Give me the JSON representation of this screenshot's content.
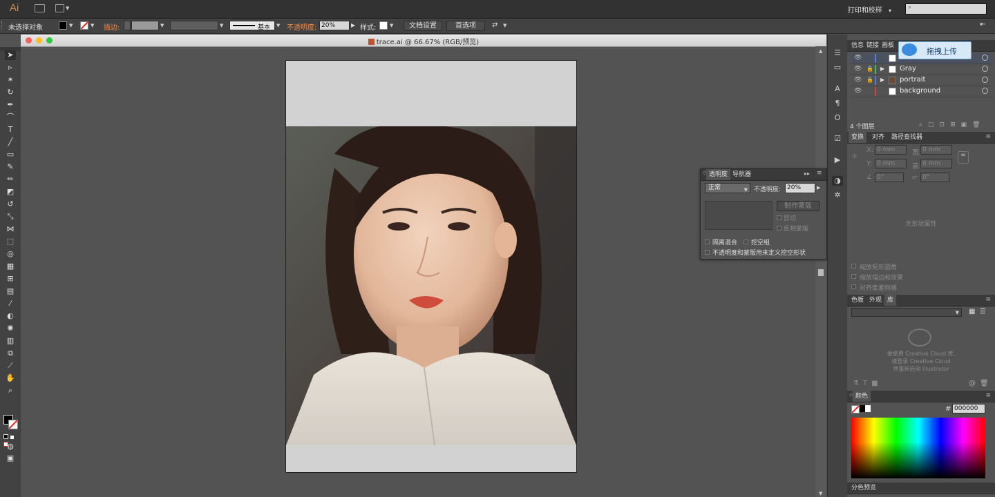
{
  "app": {
    "logo": "Ai",
    "workspace": "打印和校样",
    "workspace_arrow": "▾"
  },
  "control": {
    "selection": "未选择对象",
    "stroke_label": "描边:",
    "stroke_style": "基本",
    "opacity_label": "不透明度:",
    "opacity_value": "20%",
    "style_label": "样式:",
    "doc_setup_button": "文档设置",
    "prefs_button": "首选项"
  },
  "document": {
    "title": "trace.ai @ 66.67% (RGB/预览)"
  },
  "layers_panel": {
    "tabs": [
      "信息",
      "链接",
      "画板"
    ],
    "layers": [
      {
        "name": "trace",
        "color": "#4f7cf0"
      },
      {
        "name": "Gray",
        "color": "#34c759"
      },
      {
        "name": "portrait",
        "color": "#4f7cf0"
      },
      {
        "name": "background",
        "color": "#e53935"
      }
    ],
    "count": "4 个图层"
  },
  "upload_button": "拖拽上传",
  "transform_panel": {
    "tabs": [
      "变换",
      "对齐",
      "路径查找器"
    ],
    "x_label": "X:",
    "y_label": "Y:",
    "w_label": "宽:",
    "h_label": "高:",
    "x_value": "0 mm",
    "y_value": "0 mm",
    "w_value": "0 mm",
    "h_value": "0 mm",
    "angle_value": "0°",
    "shear_value": "0°",
    "no_shape": "无形状属性",
    "options": [
      "缩放矩形圆角",
      "缩放描边和效果",
      "对齐像素网格"
    ]
  },
  "library_panel": {
    "tabs": [
      "色板",
      "外观",
      "库"
    ],
    "message": [
      "要使用 Creative Cloud 库,",
      "请登录 Creative Cloud",
      "并重新启动 Illustrator"
    ]
  },
  "color_panel": {
    "tab": "颜色",
    "hash": "#",
    "hex_value": "000000"
  },
  "separation_tab": "分色预览",
  "transparency_panel": {
    "tabs": [
      "透明度",
      "导航器"
    ],
    "blend_mode": "正常",
    "opacity_label": "不透明度:",
    "opacity_value": "20%",
    "make_mask": "制作蒙版",
    "clip": "剪切",
    "invert_mask": "反相蒙版",
    "isolate_blending": "隔离混合",
    "knockout_group": "挖空组",
    "define_knockout": "不透明度和蒙版用来定义挖空形状"
  },
  "colors": {
    "accent_orange": "#ef8b45",
    "panel": "#535353",
    "dark": "#323232"
  }
}
